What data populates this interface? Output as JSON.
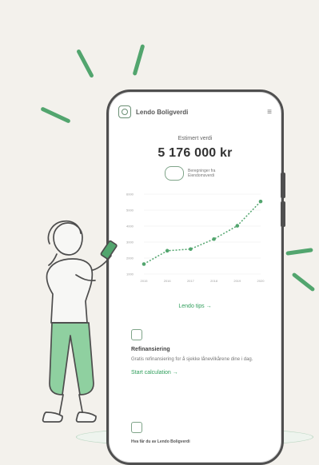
{
  "app": {
    "name": "Lendo Boligverdi"
  },
  "hero": {
    "label": "Estimert verdi",
    "value": "5 176 000 kr",
    "note": "Beregninger fra Eiendomsverdi"
  },
  "chart_data": {
    "type": "line",
    "x": [
      "2015",
      "2016",
      "2017",
      "2018",
      "2019",
      "2020"
    ],
    "series": [
      {
        "name": "",
        "values": [
          3.3,
          3.7,
          3.75,
          4.05,
          4.45,
          5.18
        ]
      }
    ],
    "ylim": [
      3.0,
      5.4
    ],
    "ticks": [
      "6000",
      "5000",
      "4000",
      "3000",
      "2000",
      "1000"
    ]
  },
  "cta": {
    "label": "Lendo tips →"
  },
  "section": {
    "title": "Refinansiering",
    "body": "Gratis refinansiering for å sjekke lånevilkårene dine i dag.",
    "link": "Start calculation →"
  },
  "bottom": {
    "text": "Hva får du av Lendo Boligverdi"
  },
  "colors": {
    "accent": "#52a56e",
    "accent_text": "#2f9e5b",
    "background": "#f3f1ec",
    "phone": "#4f4f4f"
  }
}
